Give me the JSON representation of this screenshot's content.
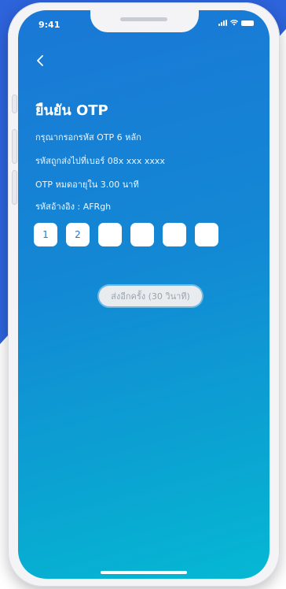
{
  "colors": {
    "screen_gradient_start": "#1a78d6",
    "screen_gradient_end": "#05b8d3",
    "background_accent": "#2d63db",
    "text": "#ffffff"
  },
  "status_bar": {
    "time": "9:41",
    "icons": [
      "signal-icon",
      "wifi-icon",
      "battery-icon"
    ]
  },
  "header": {
    "back_icon": "chevron-left-icon",
    "title": "ยืนยัน OTP"
  },
  "info": {
    "line1": "กรุณากรอกรหัส OTP 6 หลัก",
    "line2": "รหัสถูกส่งไปที่เบอร์ 08x xxx xxxx",
    "line3": "OTP หมดอายุใน 3.00 นาที",
    "line4": "รหัสอ้างอิง : AFRgh"
  },
  "otp": {
    "digits": [
      "1",
      "2",
      "",
      "",
      "",
      ""
    ]
  },
  "resend_button": {
    "label": "ส่งอีกครั้ง (30 วินาที)"
  }
}
